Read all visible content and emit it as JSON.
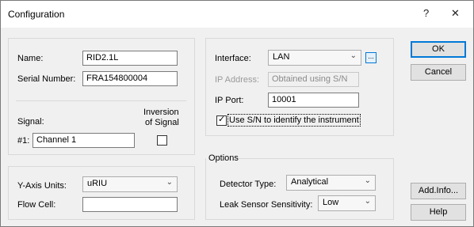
{
  "window": {
    "title": "Configuration",
    "help_glyph": "?",
    "close_glyph": "✕"
  },
  "identity": {
    "name_label": "Name:",
    "name_value": "RID2.1L",
    "serial_label": "Serial Number:",
    "serial_value": "FRA154800004"
  },
  "signal": {
    "label": "Signal:",
    "inversion_label_1": "Inversion",
    "inversion_label_2": "of Signal",
    "channel_prefix": "#1:",
    "channel_value": "Channel 1",
    "inversion_checked": false
  },
  "units": {
    "yaxis_label": "Y-Axis Units:",
    "yaxis_value": "uRIU",
    "flowcell_label": "Flow Cell:",
    "flowcell_value": ""
  },
  "connection": {
    "interface_label": "Interface:",
    "interface_value": "LAN",
    "browse_glyph": "...",
    "ip_address_label": "IP Address:",
    "ip_address_value": "Obtained using S/N",
    "ip_port_label": "IP Port:",
    "ip_port_value": "10001",
    "use_sn_label": "Use S/N to identify the instrument",
    "use_sn_checked": true
  },
  "options": {
    "group_label": "Options",
    "detector_type_label": "Detector Type:",
    "detector_type_value": "Analytical",
    "leak_sensor_label": "Leak Sensor Sensitivity:",
    "leak_sensor_value": "Low"
  },
  "buttons": {
    "ok": "OK",
    "cancel": "Cancel",
    "add_info": "Add.Info...",
    "help": "Help"
  },
  "icons": {
    "dropdown": "chevron-down-icon",
    "checkmark": "checkmark-icon"
  }
}
